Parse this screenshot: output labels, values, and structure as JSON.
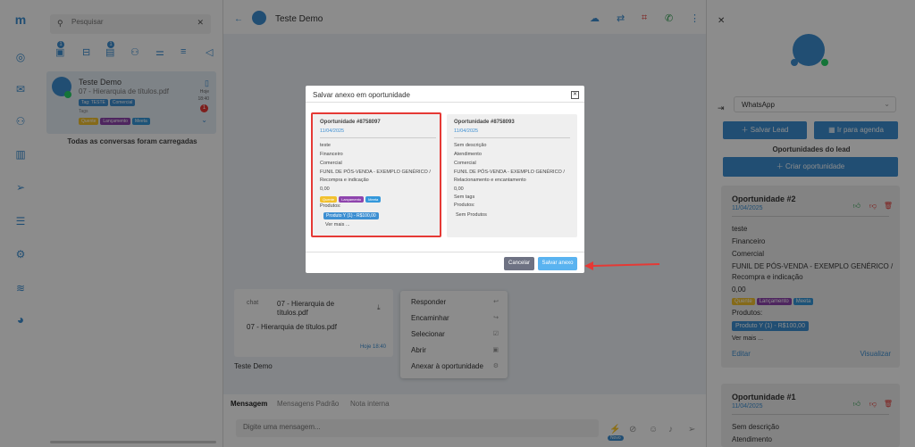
{
  "search": {
    "placeholder": "Pesquisar"
  },
  "left": {
    "badges": [
      "1",
      "1"
    ],
    "conv": {
      "name": "Teste Demo",
      "preview": "07 - Hierarquia de títulos.pdf",
      "date_label": "Hoje",
      "time": "18:40",
      "unread": "1",
      "tag_prefix": "Tag: TESTE",
      "tag_commercial": "Comercial",
      "tags_label": "Tags",
      "tags": [
        "Quente",
        "Lançamento",
        "Meeta"
      ]
    },
    "all_loaded": "Todas as conversas foram carregadas"
  },
  "header": {
    "contact_name": "Teste Demo"
  },
  "message": {
    "file_title": "07 - Hierarquia de títulos.pdf",
    "file_title_l1": "07 - Hierarquia de",
    "file_title_l2": "títulos.pdf",
    "img_alt": "chat",
    "caption": "07 - Hierarquia de títulos.pdf",
    "time": "Hoje 18:40",
    "sender": "Teste Demo"
  },
  "context_menu": [
    "Responder",
    "Encaminhar",
    "Selecionar",
    "Abrir",
    "Anexar à oportunidade"
  ],
  "composer": {
    "tabs": [
      "Mensagem",
      "Mensagens Padrão",
      "Nota interna"
    ],
    "placeholder": "Digite uma mensagem...",
    "new_badge": "Novo"
  },
  "modal": {
    "title": "Salvar anexo em oportunidade",
    "cancel": "Cancelar",
    "save": "Salvar anexo",
    "opp1": {
      "title": "Oportunidade #8758097",
      "date": "11/04/2025",
      "desc": "teste",
      "team": "Financeiro",
      "stage": "Comercial",
      "funnel": "FUNIL DE PÓS-VENDA - EXEMPLO GENÉRICO /",
      "funnel2": "Recompra e indicação",
      "value": "0,00",
      "tags": [
        "Quente",
        "Lançamento",
        "Meeta"
      ],
      "products_label": "Produtos:",
      "product": "Produto Y (1) - R$100,00",
      "see_more": "Ver mais ..."
    },
    "opp2": {
      "title": "Oportunidade #8758093",
      "date": "11/04/2025",
      "desc": "Sem descrição",
      "team": "Atendimento",
      "stage": "Comercial",
      "funnel": "FUNIL DE PÓS-VENDA - EXEMPLO GENÉRICO /",
      "funnel2": "Relacionamento e encantamento",
      "value": "0,00",
      "tags": "Sem tags",
      "products_label": "Produtos:",
      "products": "Sem Produtos"
    }
  },
  "right": {
    "channel": "WhatsApp",
    "save_lead": "Salvar Lead",
    "schedule": "Ir para agenda",
    "section_title": "Oportunidades do lead",
    "create": "Criar oportunidade",
    "opp2": {
      "title": "Oportunidade #2",
      "date": "11/04/2025",
      "desc": "teste",
      "team": "Financeiro",
      "stage": "Comercial",
      "funnel": "FUNIL DE PÓS-VENDA - EXEMPLO GENÉRICO /",
      "funnel2": "Recompra e indicação",
      "value": "0,00",
      "tags": [
        "Quente",
        "Lançamento",
        "Meeta"
      ],
      "products_label": "Produtos:",
      "product": "Produto Y (1) - R$100,00",
      "see_more": "Ver mais ...",
      "edit": "Editar",
      "view": "Visualizar"
    },
    "opp1": {
      "title": "Oportunidade #1",
      "date": "11/04/2025",
      "desc": "Sem descrição",
      "team": "Atendimento"
    }
  },
  "colors": {
    "accent": "#3d8fd2",
    "overlay": "rgba(0,0,0,0.45)",
    "danger": "#e53935",
    "tag_yellow": "#f2c12e",
    "tag_purple": "#8e44ad",
    "tag_blue": "#3498db"
  }
}
